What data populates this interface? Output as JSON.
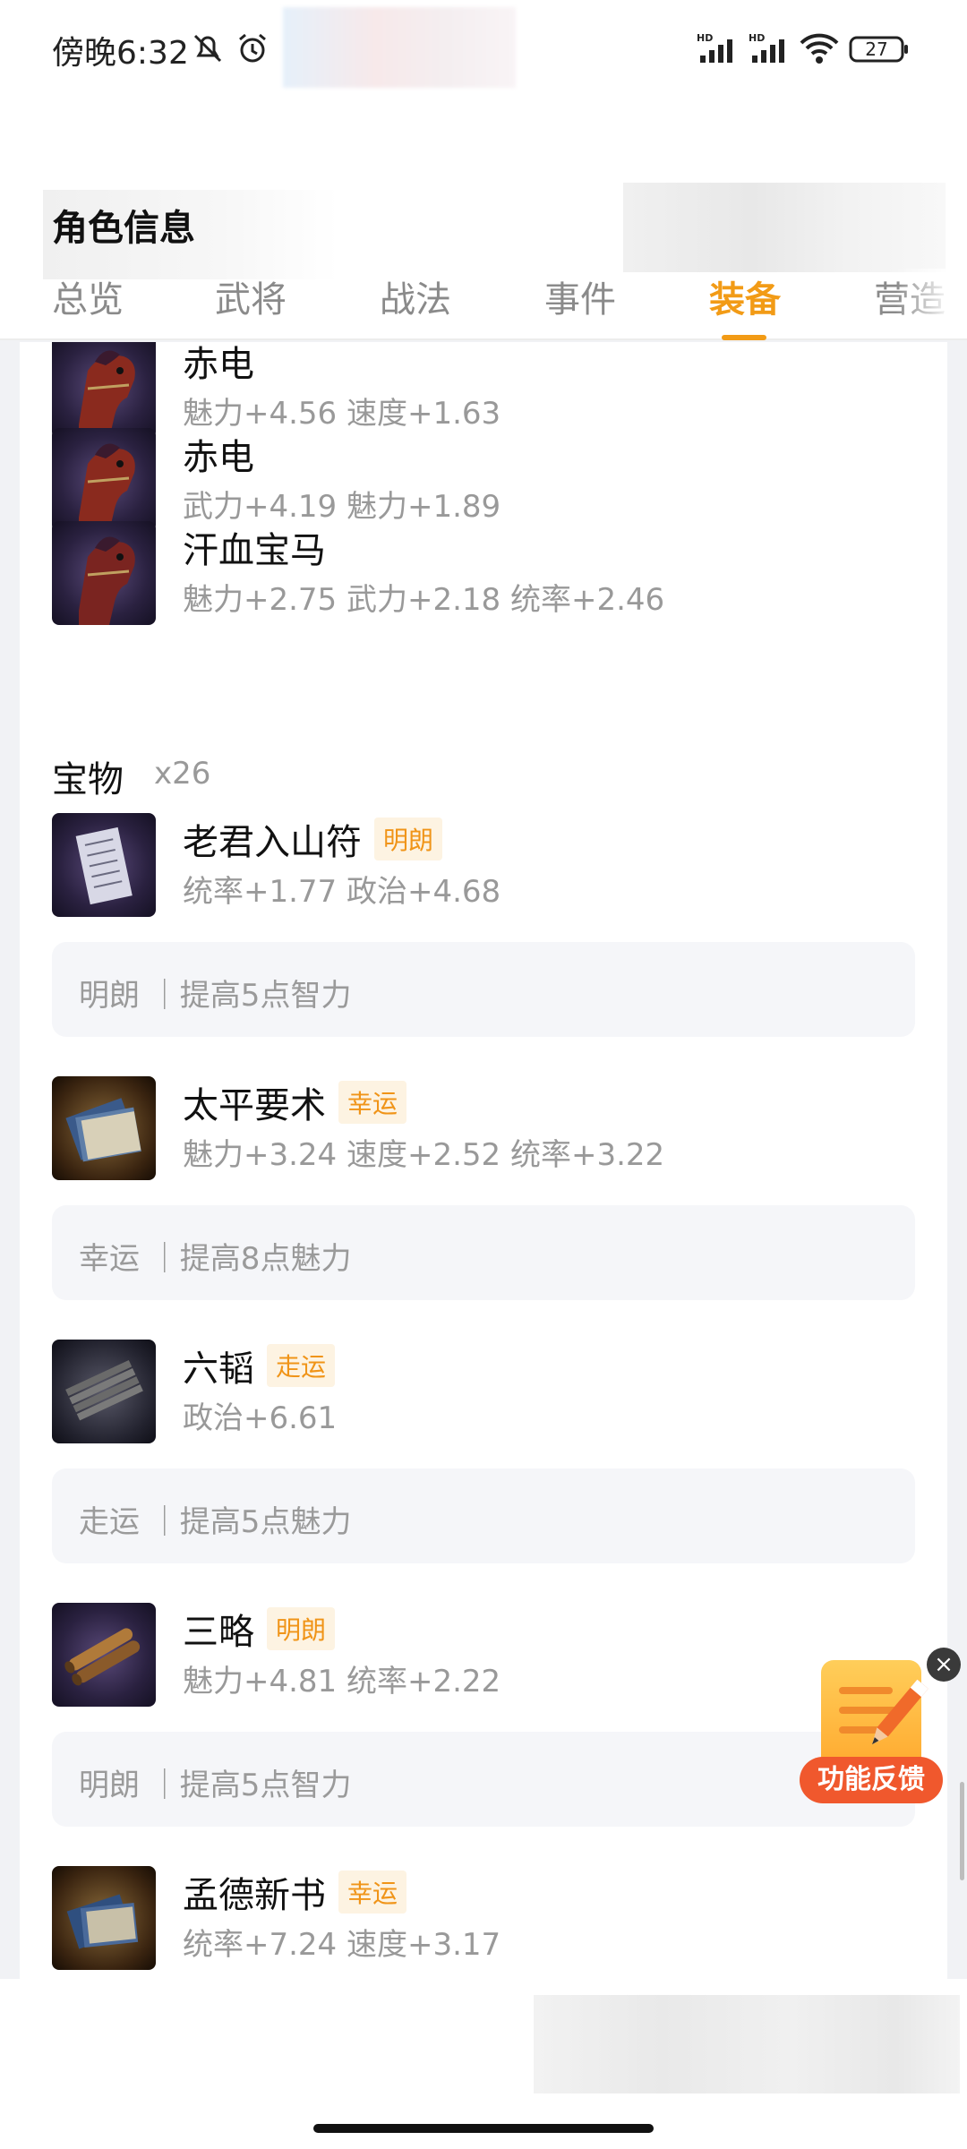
{
  "status": {
    "time": "傍晚6:32",
    "battery": "27"
  },
  "page_title": "角色信息",
  "tabs": [
    "总览",
    "武将",
    "战法",
    "事件",
    "装备",
    "营造"
  ],
  "active_tab": "装备",
  "mounts": [
    {
      "name": "赤电",
      "stats": "魅力+4.56 速度+1.63",
      "icon": "red-horse-icon"
    },
    {
      "name": "赤电",
      "stats": "武力+4.19 魅力+1.89",
      "icon": "red-horse-icon"
    },
    {
      "name": "汗血宝马",
      "stats": "魅力+2.75 武力+2.18 统率+2.46",
      "icon": "red-horse-icon"
    }
  ],
  "treasure_section": {
    "title": "宝物",
    "count": "x26"
  },
  "treasures": [
    {
      "name": "老君入山符",
      "badge": "明朗",
      "stats": "统率+1.77 政治+4.68",
      "note": "明朗 ｜提高5点智力",
      "icon": "talisman-icon"
    },
    {
      "name": "太平要术",
      "badge": "幸运",
      "stats": "魅力+3.24 速度+2.52 统率+3.22",
      "note": "幸运 ｜提高8点魅力",
      "icon": "book-icon"
    },
    {
      "name": "六韬",
      "badge": "走运",
      "stats": "政治+6.61",
      "note": "走运 ｜提高5点魅力",
      "icon": "bamboo-slips-icon"
    },
    {
      "name": "三略",
      "badge": "明朗",
      "stats": "魅力+4.81 统率+2.22",
      "note": "明朗 ｜提高5点智力",
      "icon": "scroll-icon"
    },
    {
      "name": "孟德新书",
      "badge": "幸运",
      "stats": "统率+7.24 速度+3.17",
      "icon": "book-icon"
    }
  ],
  "feedback": {
    "label": "功能反馈",
    "close": "×"
  }
}
